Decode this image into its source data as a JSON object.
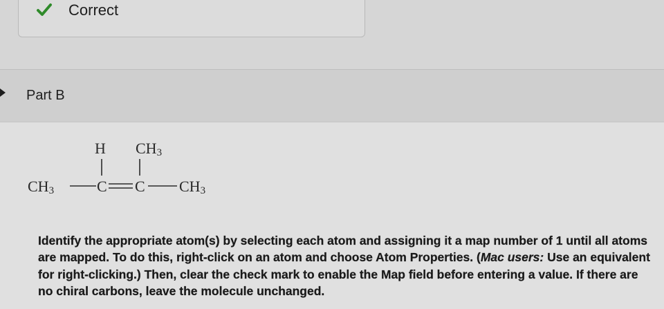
{
  "feedback": {
    "status": "Correct",
    "icon": "check-icon",
    "icon_color": "#2f8a2a"
  },
  "part": {
    "title": "Part B",
    "icon": "collapse-triangle-icon"
  },
  "molecule": {
    "atoms": {
      "h_top": "H",
      "ch3_top": "CH3",
      "ch3_left": "CH3",
      "c_left": "C",
      "c_right": "C",
      "ch3_right": "CH3"
    }
  },
  "instructions": {
    "part1": "Identify the appropriate atom(s) by selecting each atom and assigning it a map number of 1 until all atoms are mapped. To do this, right-click on an atom and choose Atom Properties. (",
    "mac_users": "Mac users:",
    "part2": " Use an equivalent for right-clicking.) Then, clear the check mark to enable the Map field before entering a value. If there are no chiral carbons, leave the molecule unchanged."
  }
}
